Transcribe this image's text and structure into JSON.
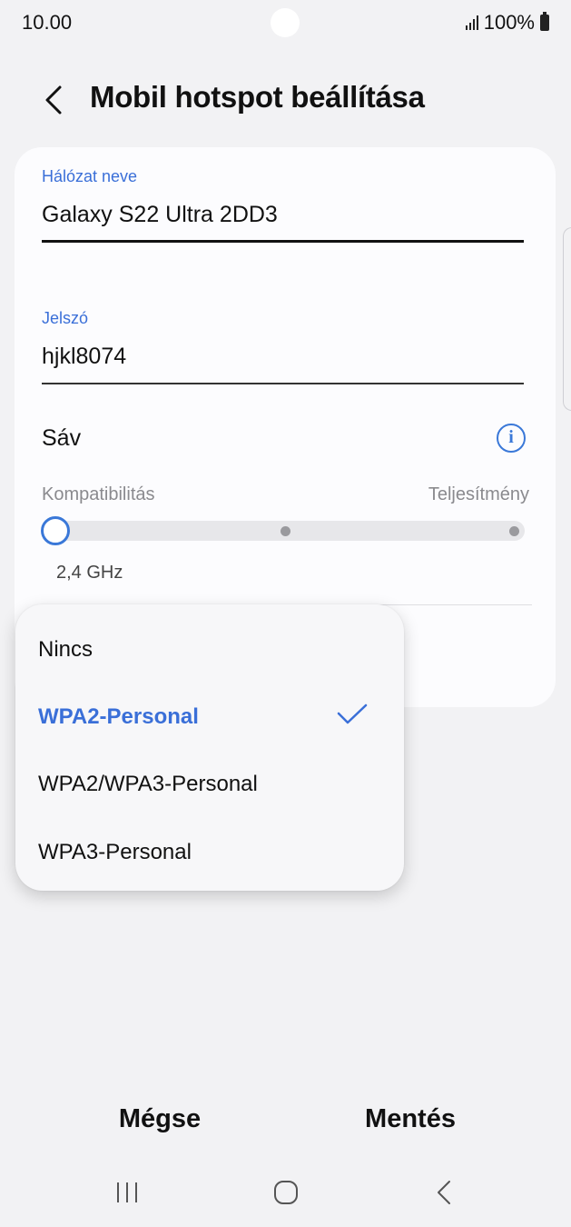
{
  "status": {
    "time": "10.00",
    "battery": "100%"
  },
  "header": {
    "title": "Mobil hotspot beállítása"
  },
  "network": {
    "label": "Hálózat neve",
    "value": "Galaxy S22 Ultra 2DD3"
  },
  "password": {
    "label": "Jelszó",
    "value": "hjkl8074"
  },
  "band": {
    "label": "Sáv",
    "left_label": "Kompatibilitás",
    "right_label": "Teljesítmény",
    "value_label": "2,4 GHz",
    "position": 0
  },
  "security_menu": {
    "options": [
      "Nincs",
      "WPA2-Personal",
      "WPA2/WPA3-Personal",
      "WPA3-Personal"
    ],
    "selected": "WPA2-Personal"
  },
  "actions": {
    "cancel": "Mégse",
    "save": "Mentés"
  },
  "colors": {
    "accent": "#3a6fd8",
    "background": "#f2f2f4",
    "card": "#fcfcfe"
  },
  "icons": [
    "back-arrow-icon",
    "info-icon",
    "check-icon",
    "recents-icon",
    "home-icon",
    "nav-back-icon",
    "signal-icon",
    "battery-icon"
  ]
}
